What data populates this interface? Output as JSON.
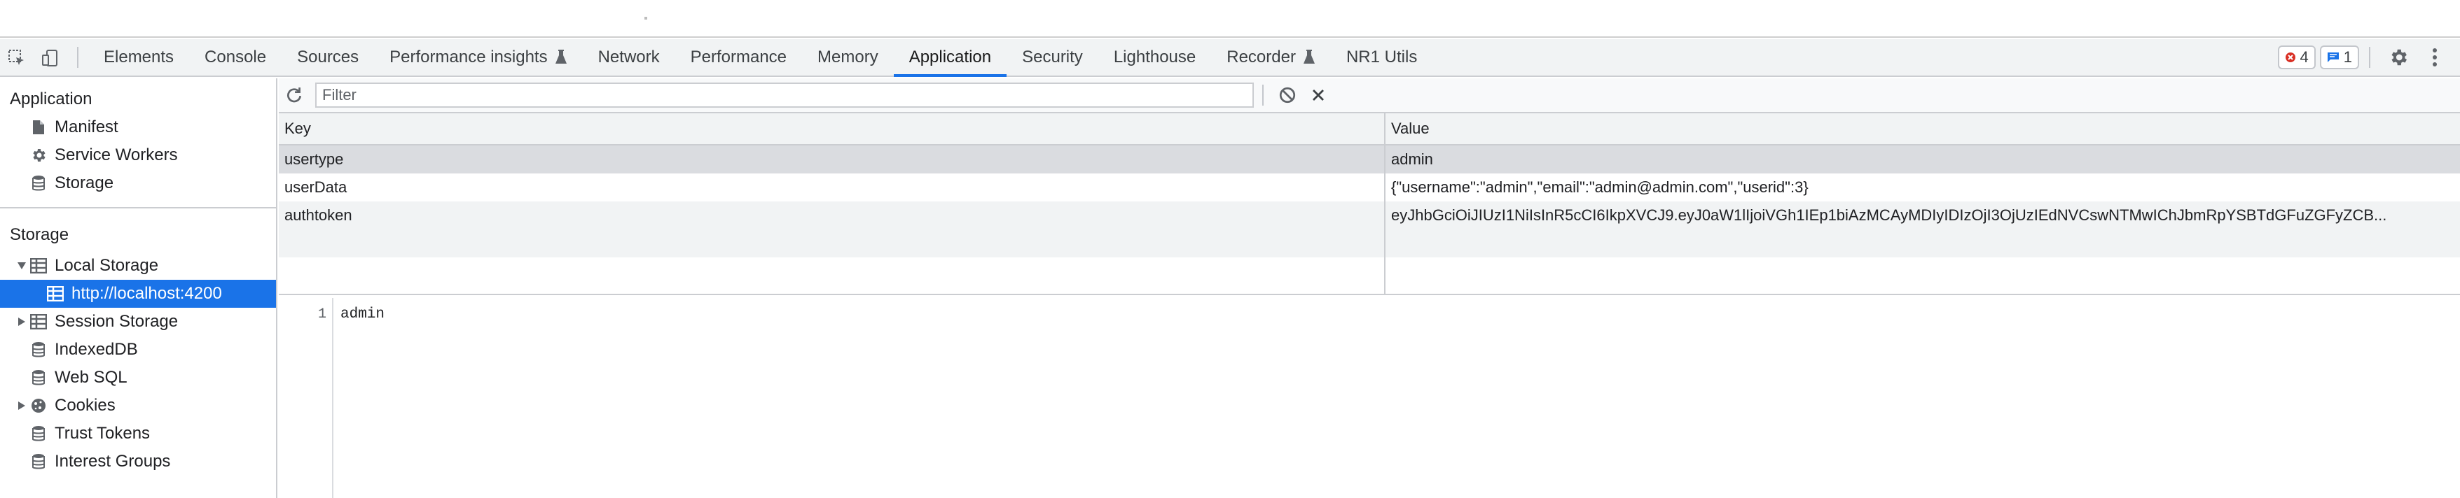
{
  "tabs": [
    {
      "label": "Elements",
      "experimental": false
    },
    {
      "label": "Console",
      "experimental": false
    },
    {
      "label": "Sources",
      "experimental": false
    },
    {
      "label": "Performance insights",
      "experimental": true
    },
    {
      "label": "Network",
      "experimental": false
    },
    {
      "label": "Performance",
      "experimental": false
    },
    {
      "label": "Memory",
      "experimental": false
    },
    {
      "label": "Application",
      "experimental": false,
      "active": true
    },
    {
      "label": "Security",
      "experimental": false
    },
    {
      "label": "Lighthouse",
      "experimental": false
    },
    {
      "label": "Recorder",
      "experimental": true
    },
    {
      "label": "NR1 Utils",
      "experimental": false
    }
  ],
  "badges": {
    "errors": "4",
    "messages": "1"
  },
  "sidebar": {
    "application_header": "Application",
    "application_items": [
      "Manifest",
      "Service Workers",
      "Storage"
    ],
    "storage_header": "Storage",
    "local_storage": "Local Storage",
    "local_storage_origin": "http://localhost:4200",
    "session_storage": "Session Storage",
    "indexeddb": "IndexedDB",
    "websql": "Web SQL",
    "cookies": "Cookies",
    "trust_tokens": "Trust Tokens",
    "interest_groups": "Interest Groups"
  },
  "toolbar": {
    "filter_placeholder": "Filter"
  },
  "table": {
    "headers": {
      "key": "Key",
      "value": "Value"
    },
    "rows": [
      {
        "key": "usertype",
        "value": "admin"
      },
      {
        "key": "userData",
        "value": "{\"username\":\"admin\",\"email\":\"admin@admin.com\",\"userid\":3}"
      },
      {
        "key": "authtoken",
        "value": "eyJhbGciOiJIUzI1NiIsInR5cCI6IkpXVCJ9.eyJ0aW1lIjoiVGh1IEp1biAzMCAyMDIyIDIzOjI3OjUzIEdNVCswNTMwIChJbmRpYSBTdGFuZGFyZCB..."
      }
    ]
  },
  "preview": {
    "line_number": "1",
    "value": "admin"
  },
  "colors": {
    "accent": "#1a73e8",
    "error": "#d93025",
    "selected_row": "#dadce0"
  }
}
